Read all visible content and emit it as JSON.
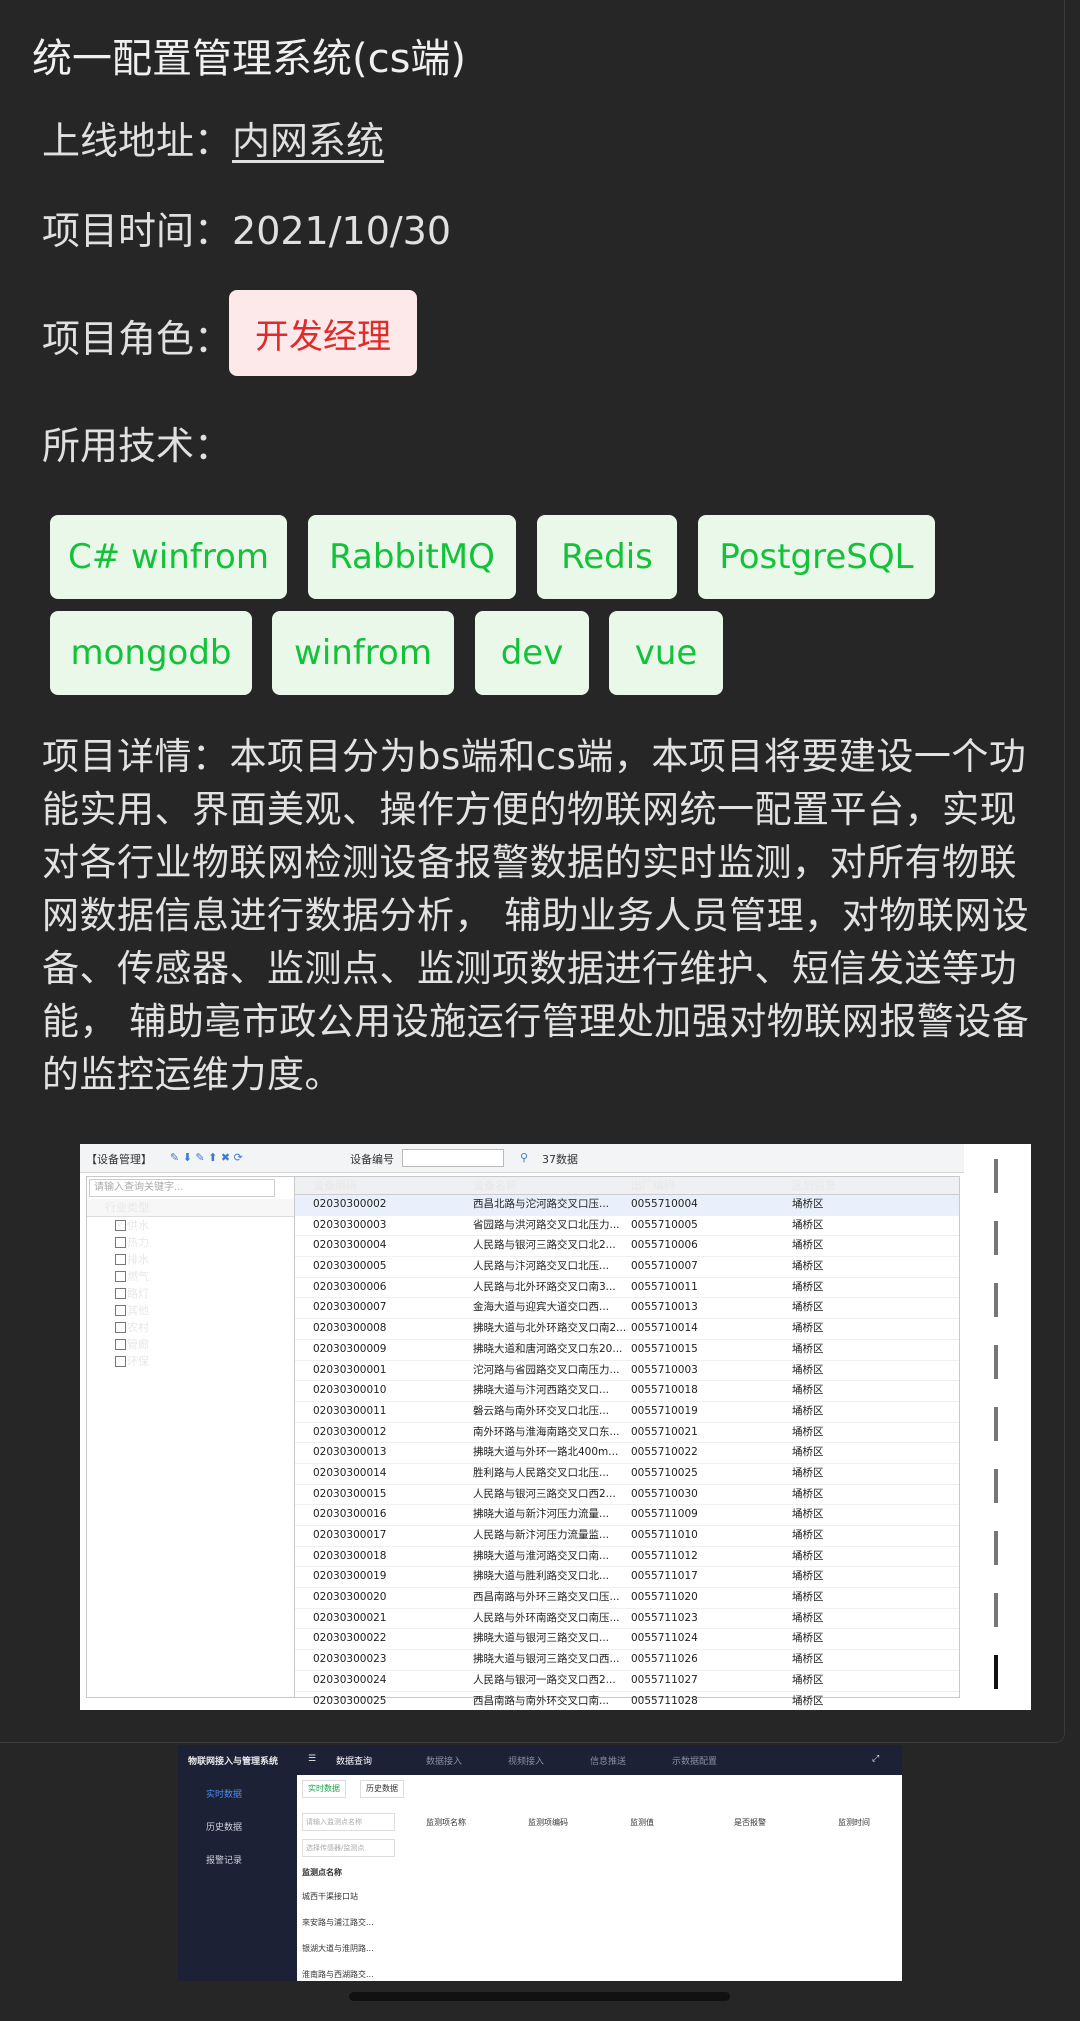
{
  "title": "统一配置管理系统(cs端)",
  "online": {
    "label": "上线地址：",
    "link": "内网系统"
  },
  "time": {
    "label": "项目时间：",
    "value": "2021/10/30"
  },
  "role": {
    "label": "项目角色：",
    "value": "开发经理"
  },
  "tech": {
    "label": "所用技术：",
    "tags": [
      "C# winfrom",
      "RabbitMQ",
      "Redis",
      "PostgreSQL",
      "mongodb",
      "winfrom",
      "dev",
      "vue"
    ]
  },
  "detail": "项目详情：本项目分为bs端和cs端，本项目将要建设一个功能实用、界面美观、操作方便的物联网统一配置平台，实现对各行业物联网检测设备报警数据的实时监测，对所有物联网数据信息进行数据分析， 辅助业务人员管理，对物联网设备、传感器、监测点、监测项数据进行维护、短信发送等功能， 辅助亳市政公用设施运行管理处加强对物联网报警设备的监控运维力度。",
  "shot1": {
    "toolbar": {
      "title": "【设备管理】",
      "device_no": "设备编号",
      "count": "37数据"
    },
    "search_placeholder": "请输入查询关键字...",
    "tree": {
      "head": "行业类型",
      "items": [
        "供水",
        "热力",
        "排水",
        "燃气",
        "路灯",
        "其他",
        "农村",
        "管廊",
        "环保"
      ]
    },
    "columns": [
      "设备编码",
      "设备名称",
      "出厂编码",
      "区划信息"
    ],
    "rows": [
      [
        "02030300002",
        "西昌北路与沱河路交叉口压...",
        "0055710004",
        "埇桥区"
      ],
      [
        "02030300003",
        "省园路与洪河路交叉口北压力...",
        "0055710005",
        "埇桥区"
      ],
      [
        "02030300004",
        "人民路与银河三路交叉口北2...",
        "0055710006",
        "埇桥区"
      ],
      [
        "02030300005",
        "人民路与汴河路交叉口北压...",
        "0055710007",
        "埇桥区"
      ],
      [
        "02030300006",
        "人民路与北外环路交叉口南3...",
        "0055710011",
        "埇桥区"
      ],
      [
        "02030300007",
        "金海大道与迎宾大道交口西...",
        "0055710013",
        "埇桥区"
      ],
      [
        "02030300008",
        "拂晓大道与北外环路交叉口南2...",
        "0055710014",
        "埇桥区"
      ],
      [
        "02030300009",
        "拂晓大道和唐河路交叉口东20...",
        "0055710015",
        "埇桥区"
      ],
      [
        "02030300001",
        "沱河路与省园路交叉口南压力...",
        "0055710003",
        "埇桥区"
      ],
      [
        "02030300010",
        "拂晓大道与汴河西路交叉口...",
        "0055710018",
        "埇桥区"
      ],
      [
        "02030300011",
        "磬云路与南外环交叉口北压...",
        "0055710019",
        "埇桥区"
      ],
      [
        "02030300012",
        "南外环路与淮海南路交叉口东...",
        "0055710021",
        "埇桥区"
      ],
      [
        "02030300013",
        "拂晓大道与外环一路北400m...",
        "0055710022",
        "埇桥区"
      ],
      [
        "02030300014",
        "胜利路与人民路交叉口北压...",
        "0055710025",
        "埇桥区"
      ],
      [
        "02030300015",
        "人民路与银河三路交叉口西2...",
        "0055710030",
        "埇桥区"
      ],
      [
        "02030300016",
        "拂晓大道与新汴河压力流量...",
        "0055711009",
        "埇桥区"
      ],
      [
        "02030300017",
        "人民路与新汴河压力流量监...",
        "0055711010",
        "埇桥区"
      ],
      [
        "02030300018",
        "拂晓大道与淮河路交叉口南...",
        "0055711012",
        "埇桥区"
      ],
      [
        "02030300019",
        "拂晓大道与胜利路交叉口北...",
        "0055711017",
        "埇桥区"
      ],
      [
        "02030300020",
        "西昌南路与外环三路交叉口压...",
        "0055711020",
        "埇桥区"
      ],
      [
        "02030300021",
        "人民路与外环南路交叉口南压...",
        "0055711023",
        "埇桥区"
      ],
      [
        "02030300022",
        "拂晓大道与银河三路交叉口...",
        "0055711024",
        "埇桥区"
      ],
      [
        "02030300023",
        "拂晓大道与银河三路交叉口西...",
        "0055711026",
        "埇桥区"
      ],
      [
        "02030300024",
        "人民路与银河一路交叉口西2...",
        "0055711027",
        "埇桥区"
      ],
      [
        "02030300025",
        "西昌南路与南外环交叉口南...",
        "0055711028",
        "埇桥区"
      ]
    ]
  },
  "shot2": {
    "app_title": "物联网接入与管理系统",
    "nav": [
      "数据查询",
      "数据接入",
      "视频接入",
      "信息推送",
      "示数据配置"
    ],
    "side": [
      "实时数据",
      "历史数据",
      "报警记录"
    ],
    "tabs": [
      "实时数据",
      "历史数据"
    ],
    "inputs": [
      "请输入监测点名称",
      "选择传感器/监测点"
    ],
    "list_head": "监测点名称",
    "list": [
      "城西干渠接口站",
      "來安路与浦江路交...",
      "银湖大道与淮阴路...",
      "淮南路与西湖路交..."
    ],
    "columns": [
      "监测项名称",
      "监测项编码",
      "监测值",
      "是否报警",
      "监测时间"
    ]
  }
}
